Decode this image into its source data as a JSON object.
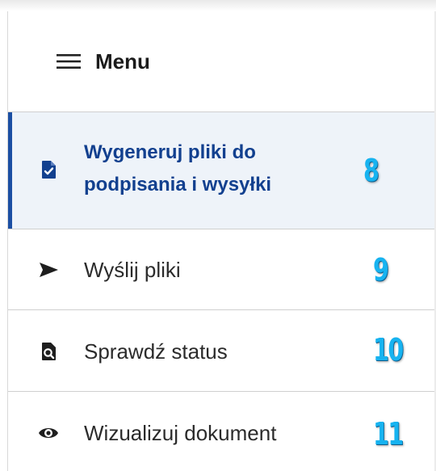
{
  "menu": {
    "title": "Menu",
    "items": [
      {
        "label_line1": "Wygeneruj pliki do",
        "label_line2": "podpisania i wysyłki",
        "icon": "file-check-icon",
        "badge": "8",
        "active": true
      },
      {
        "label": "Wyślij pliki",
        "icon": "send-icon",
        "badge": "9"
      },
      {
        "label": "Sprawdź status",
        "icon": "document-search-icon",
        "badge": "10"
      },
      {
        "label": "Wizualizuj dokument",
        "icon": "eye-icon",
        "badge": "11"
      }
    ]
  },
  "colors": {
    "accent": "#1b4fa3",
    "active_bg": "#eef3f9",
    "badge": "#17b3f0"
  }
}
